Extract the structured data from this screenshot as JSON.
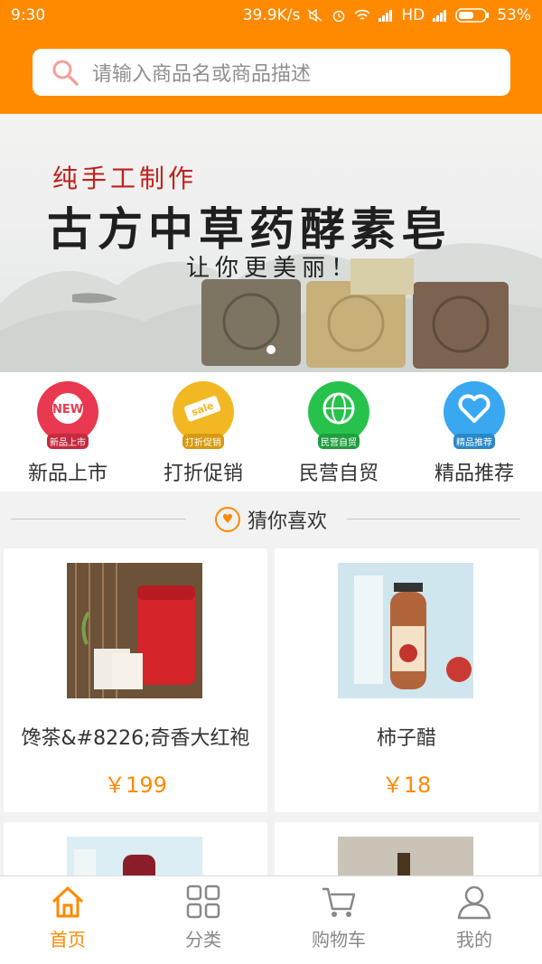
{
  "status_bar": {
    "time": "9:30",
    "network_speed": "39.9K/s",
    "network_type": "HD",
    "battery": "53%"
  },
  "search": {
    "placeholder": "请输入商品名或商品描述"
  },
  "banner": {
    "line1": "纯手工制作",
    "line2": "古方中草药酵素皂",
    "line3": "让你更美丽！"
  },
  "categories": [
    {
      "label": "新品上市",
      "tag": "新品上市",
      "badge": "NEW",
      "color": "#e9384f"
    },
    {
      "label": "打折促销",
      "tag": "打折促销",
      "badge": "sale",
      "color": "#f2b823"
    },
    {
      "label": "民营自贸",
      "tag": "民营自贸",
      "badge": "globe",
      "color": "#27c24c"
    },
    {
      "label": "精品推荐",
      "tag": "精品推荐",
      "badge": "heart",
      "color": "#3aa8f0"
    }
  ],
  "section": {
    "title": "猜你喜欢"
  },
  "products": [
    {
      "name": "馋茶&#8226;奇香大红袍",
      "price": "￥199"
    },
    {
      "name": "柿子醋",
      "price": "￥18"
    }
  ],
  "tabs": [
    {
      "label": "首页",
      "icon": "home-icon",
      "active": true
    },
    {
      "label": "分类",
      "icon": "grid-icon",
      "active": false
    },
    {
      "label": "购物车",
      "icon": "cart-icon",
      "active": false
    },
    {
      "label": "我的",
      "icon": "user-icon",
      "active": false
    }
  ],
  "colors": {
    "accent": "#ff8a00",
    "text": "#333333",
    "muted": "#888888"
  }
}
